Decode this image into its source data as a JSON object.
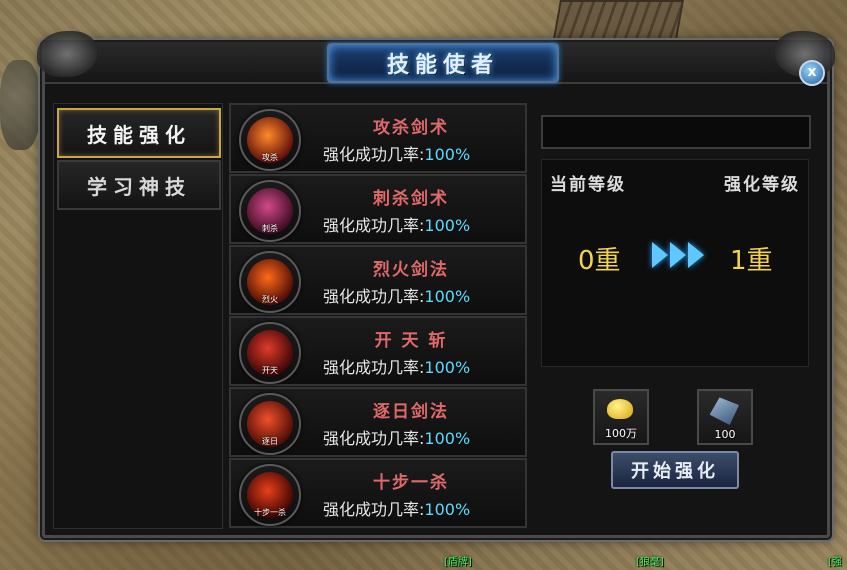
{
  "window": {
    "title": "技能使者",
    "close_label": "x"
  },
  "sidebar": {
    "items": [
      {
        "label": "技能强化",
        "active": true
      },
      {
        "label": "学习神技",
        "active": false
      }
    ]
  },
  "skills": [
    {
      "icon_tag": "攻杀",
      "name": "攻杀剑术",
      "rate_label": "强化成功几率:",
      "rate_value": "100%",
      "colors": [
        "#ff8a2a",
        "#5a0a0a"
      ]
    },
    {
      "icon_tag": "刺杀",
      "name": "刺杀剑术",
      "rate_label": "强化成功几率:",
      "rate_value": "100%",
      "colors": [
        "#d04a8a",
        "#3a0a20"
      ]
    },
    {
      "icon_tag": "烈火",
      "name": "烈火剑法",
      "rate_label": "强化成功几率:",
      "rate_value": "100%",
      "colors": [
        "#ff6a1a",
        "#4a0a05"
      ]
    },
    {
      "icon_tag": "开天",
      "name": "开 天 斩",
      "rate_label": "强化成功几率:",
      "rate_value": "100%",
      "colors": [
        "#e03a2a",
        "#3a0505"
      ]
    },
    {
      "icon_tag": "逐日",
      "name": "逐日剑法",
      "rate_label": "强化成功几率:",
      "rate_value": "100%",
      "colors": [
        "#f0502a",
        "#4a0a05"
      ]
    },
    {
      "icon_tag": "十步一杀",
      "name": "十步一杀",
      "rate_label": "强化成功几率:",
      "rate_value": "100%",
      "colors": [
        "#e8401a",
        "#3a0202"
      ]
    }
  ],
  "enhance": {
    "current_label": "当前等级",
    "target_label": "强化等级",
    "current_value": "0重",
    "target_value": "1重",
    "gold_qty": "100万",
    "stone_qty": "100",
    "start_label": "开始强化"
  },
  "scene": {
    "name_tags": [
      "[盾牌]",
      "[狼毫]",
      "[强"
    ]
  },
  "colors": {
    "accent_blue": "#5fc9ff",
    "rate_pct": "#5fd9ff",
    "skill_name": "#e06a6a",
    "level_value": "#f4d44a"
  }
}
